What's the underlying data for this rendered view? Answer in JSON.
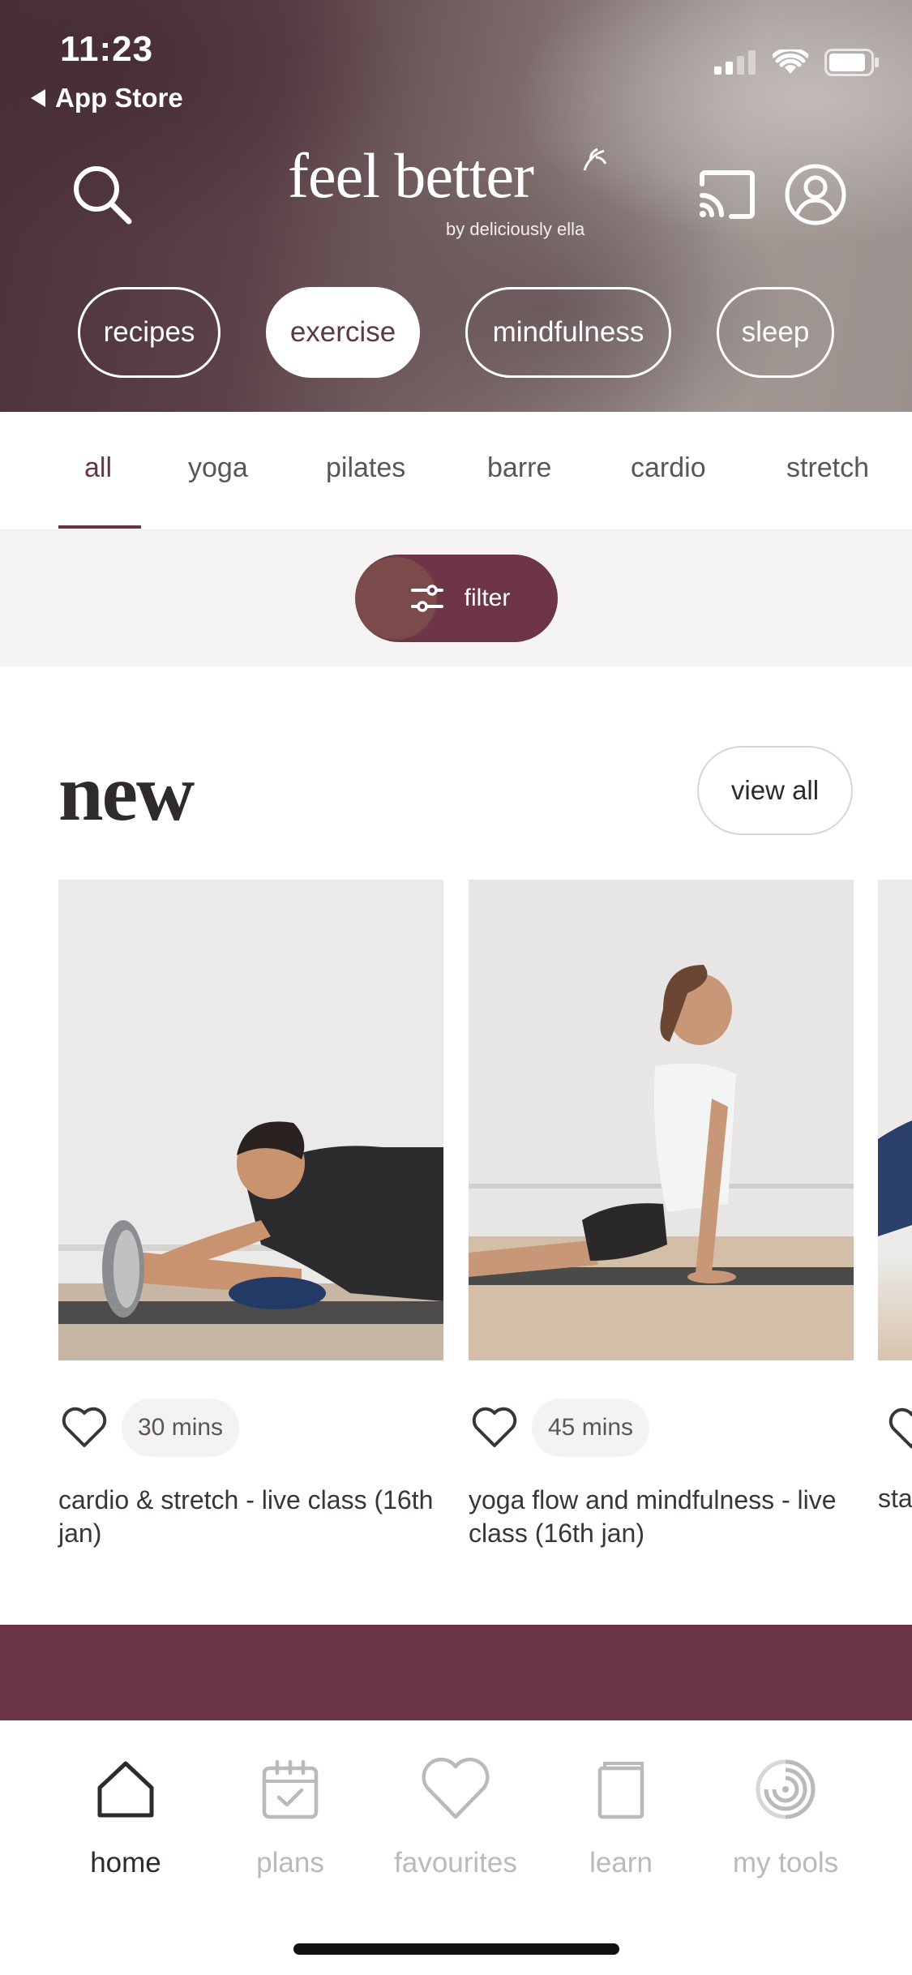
{
  "status_bar": {
    "time": "11:23",
    "back_label": "App Store"
  },
  "header": {
    "logo_text": "feel better",
    "logo_subtitle": "by deliciously ella",
    "categories": [
      {
        "label": "recipes",
        "active": false
      },
      {
        "label": "exercise",
        "active": true
      },
      {
        "label": "mindfulness",
        "active": false
      },
      {
        "label": "sleep",
        "active": false
      }
    ]
  },
  "subtabs": [
    {
      "label": "all",
      "active": true
    },
    {
      "label": "yoga",
      "active": false
    },
    {
      "label": "pilates",
      "active": false
    },
    {
      "label": "barre",
      "active": false
    },
    {
      "label": "cardio",
      "active": false
    },
    {
      "label": "stretch",
      "active": false
    }
  ],
  "filter": {
    "label": "filter"
  },
  "new_section": {
    "title": "new",
    "view_all_label": "view all",
    "cards": [
      {
        "duration": "30 mins",
        "title": "cardio & stretch - live class (16th jan)"
      },
      {
        "duration": "45 mins",
        "title": "yoga flow and mindfulness - live class (16th jan)"
      },
      {
        "duration": "",
        "title": "sta"
      }
    ]
  },
  "tabbar": [
    {
      "label": "home",
      "icon": "home-icon",
      "active": true
    },
    {
      "label": "plans",
      "icon": "calendar-check-icon",
      "active": false
    },
    {
      "label": "favourites",
      "icon": "heart-icon",
      "active": false
    },
    {
      "label": "learn",
      "icon": "book-icon",
      "active": false
    },
    {
      "label": "my tools",
      "icon": "tools-spiral-icon",
      "active": false
    }
  ],
  "colors": {
    "brand": "#6b3444",
    "active_tab": "#2f2a2b",
    "inactive_tab": "#bdb8b9"
  }
}
